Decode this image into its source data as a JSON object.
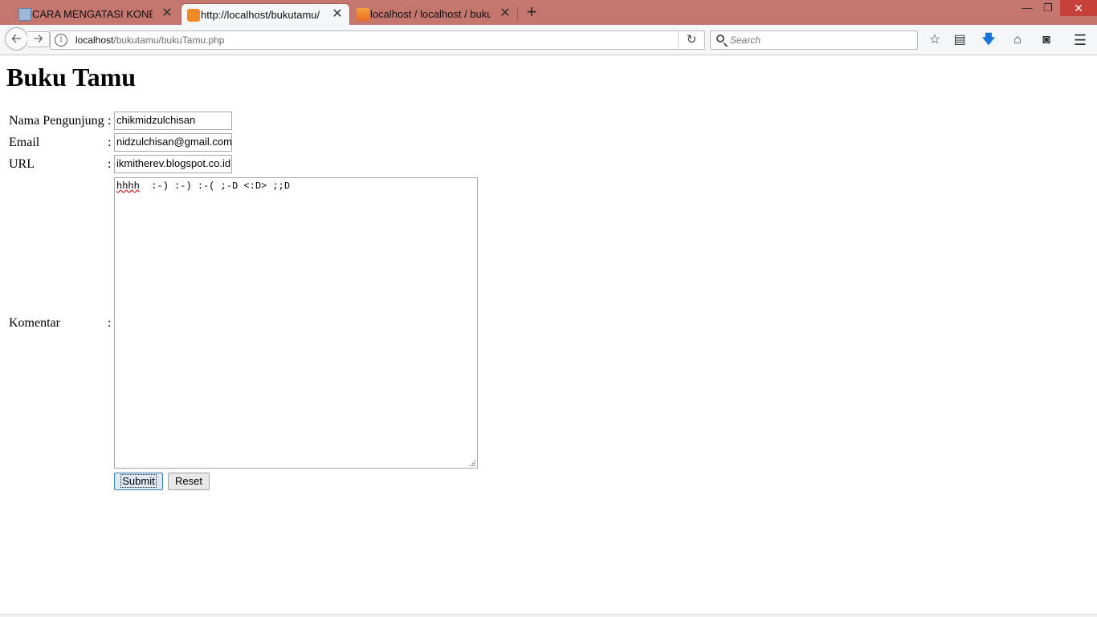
{
  "browser": {
    "tabs": [
      {
        "label": "CARA MENGATASI KONEKSI",
        "active": false
      },
      {
        "label": "http://localhost/bukutamu/",
        "active": true
      },
      {
        "label": "localhost / localhost / bukut",
        "active": false
      }
    ],
    "new_tab_label": "+",
    "window_controls": {
      "minimize": "—",
      "restore": "❐",
      "close": "✕"
    },
    "url": {
      "host": "localhost",
      "path": "/bukutamu/bukuTamu.php"
    },
    "search_placeholder": "Search",
    "toolbar_icons": [
      "bookmark-star-icon",
      "reading-list-icon",
      "downloads-icon",
      "home-icon",
      "pocket-icon",
      "menu-icon"
    ],
    "accent_color": "#c4766f"
  },
  "page": {
    "title": "Buku Tamu",
    "colon": ":",
    "fields": {
      "nama": {
        "label": "Nama Pengunjung",
        "value": "chikmidzulchisan"
      },
      "email": {
        "label": "Email",
        "value": "nidzulchisan@gmail.com"
      },
      "url": {
        "label": "URL",
        "value": "ikmitherev.blogspot.co.id"
      },
      "komentar": {
        "label": "Komentar",
        "value_word": "hhhh",
        "value_rest": "  :-) :-) :-( ;-D <:D> ;;D"
      }
    },
    "buttons": {
      "submit": "Submit",
      "reset": "Reset"
    }
  }
}
